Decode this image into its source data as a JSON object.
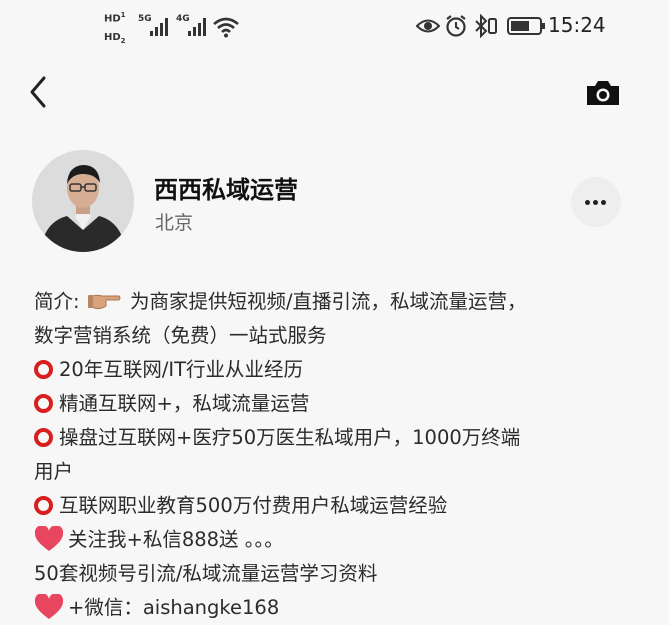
{
  "status_bar": {
    "hd1": "HD",
    "hd1_sub": "1",
    "hd2": "HD",
    "hd2_sub": "2",
    "net1": "5G",
    "net2": "4G",
    "time": "15:24"
  },
  "profile": {
    "name": "西西私域运营",
    "location": "北京"
  },
  "bio": {
    "intro_label": "简介:",
    "intro_rest": "为商家提供短视频/直播引流，私域流量运营，",
    "line2": "数字营销系统（免费）一站式服务",
    "item1": "20年互联网/IT行业从业经历",
    "item2": "精通互联网+，私域流量运营",
    "item3a": "操盘过互联网+医疗50万医生私域用户，1000万终端",
    "item3b": "用户",
    "item4": "互联网职业教育500万付费用户私域运营经验",
    "heart1": "关注我+私信888送 。。。",
    "line9": "50套视频号引流/私域流量运营学习资料",
    "heart2": "+微信：aishangke168"
  },
  "colors": {
    "background": "#f7f7f7",
    "ring_red": "#d81e1e",
    "heart_pink": "#e8465e"
  }
}
